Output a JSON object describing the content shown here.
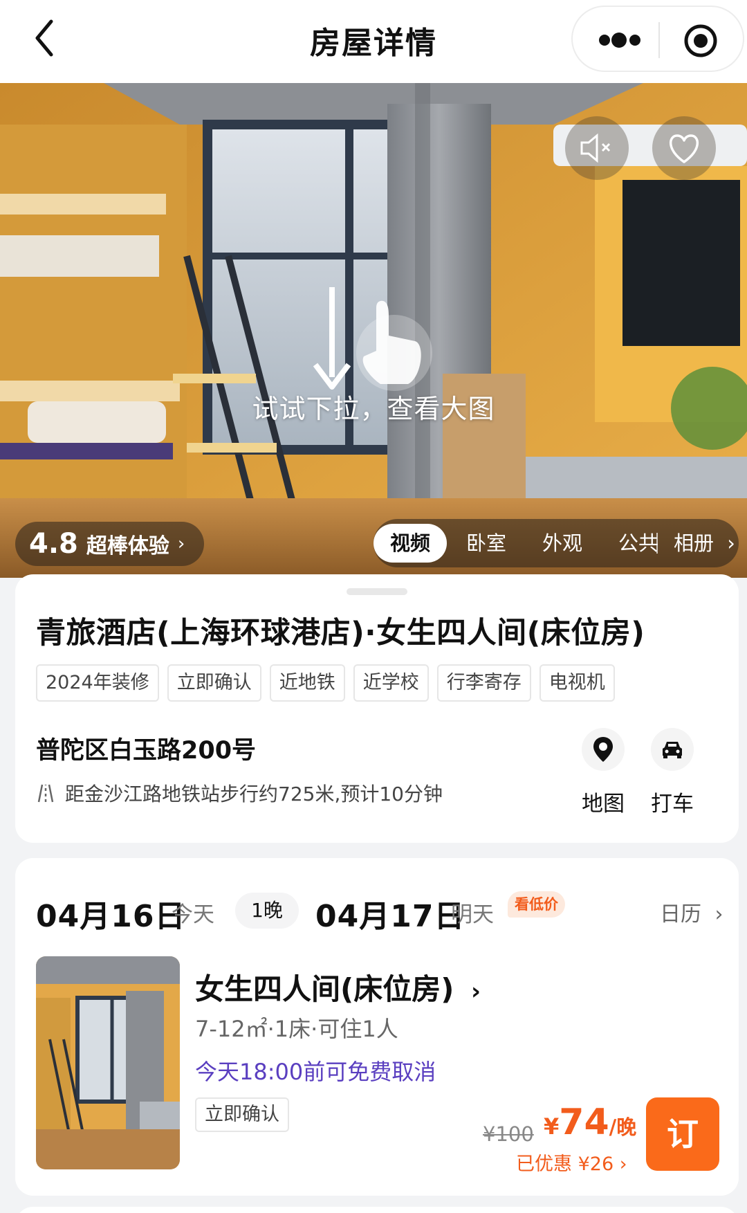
{
  "header": {
    "title": "房屋详情",
    "back_icon": "back-arrow-icon",
    "more_icon": "more-dots-icon",
    "close_icon": "target-icon"
  },
  "hero": {
    "swipe_tip": "试试下拉，查看大图",
    "rating": {
      "score": "4.8",
      "label": "超棒体验",
      "chevron": "›"
    },
    "media_tabs": [
      "视频",
      "卧室",
      "外观",
      "公共"
    ],
    "album_label": "相册",
    "album_chevron": "›",
    "active_tab_index": 0,
    "colors": {
      "wall": "#e7a73e",
      "frame": "#2f3a4a",
      "curtain": "#8b8e92"
    }
  },
  "hotel": {
    "name": "青旅酒店(上海环球港店)·女生四人间(床位房)",
    "tags": [
      "2024年装修",
      "立即确认",
      "近地铁",
      "近学校",
      "行李寄存",
      "电视机"
    ],
    "address": "普陀区白玉路200号",
    "metro_text": "距金沙江路地铁站步行约725米,预计10分钟",
    "actions": [
      {
        "label": "地图",
        "icon": "location-pin-icon"
      },
      {
        "label": "打车",
        "icon": "car-icon"
      }
    ]
  },
  "booking": {
    "checkin_date": "04月16日",
    "checkin_day": "今天",
    "nights": "1晚",
    "checkout_date": "04月17日",
    "checkout_day": "明天",
    "low_price_badge": "看低价",
    "calendar_label": "日历",
    "chevron": "›",
    "room": {
      "name": "女生四人间(床位房)",
      "spec": "7-12㎡·1床·可住1人",
      "cancel_policy": "今天18:00前可免费取消",
      "confirm_tag": "立即确认",
      "original_price": "¥100",
      "price_currency": "¥",
      "price_amount": "74",
      "price_unit": "/晚",
      "discount": "已优惠 ¥26 ›",
      "book_label": "订"
    },
    "colors": {
      "accent": "#fa6a1a",
      "cancel": "#5a3fc0"
    }
  }
}
